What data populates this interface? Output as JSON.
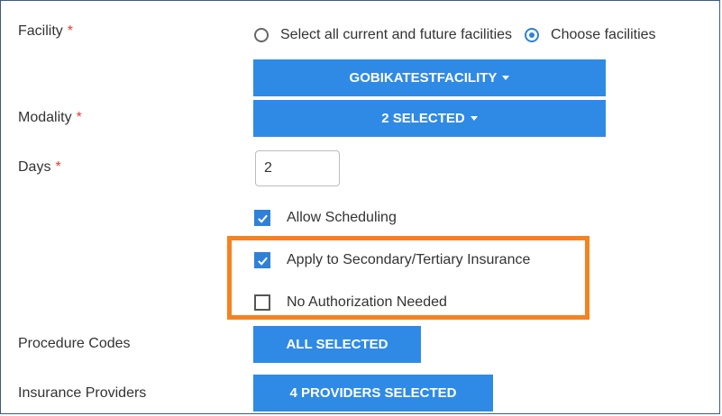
{
  "form": {
    "facility": {
      "label": "Facility",
      "required_mark": "*",
      "option_all_label": "Select all current and future facilities",
      "option_choose_label": "Choose facilities",
      "selected_option": "choose",
      "dropdown_label": "GOBIKATESTFACILITY"
    },
    "modality": {
      "label": "Modality",
      "required_mark": "*",
      "dropdown_label": "2 SELECTED"
    },
    "days": {
      "label": "Days",
      "required_mark": "*",
      "value": "2"
    },
    "checkboxes": {
      "allow_scheduling": {
        "label": "Allow Scheduling",
        "checked": true
      },
      "apply_secondary": {
        "label": "Apply to Secondary/Tertiary Insurance",
        "checked": true
      },
      "no_authorization": {
        "label": "No Authorization Needed",
        "checked": false
      }
    },
    "procedure_codes": {
      "label": "Procedure Codes",
      "button_label": "ALL SELECTED"
    },
    "insurance_providers": {
      "label": "Insurance Providers",
      "button_label": "4 PROVIDERS SELECTED"
    }
  },
  "colors": {
    "accent": "#2f8ae6",
    "required": "#e53935",
    "highlight": "#f58220"
  }
}
